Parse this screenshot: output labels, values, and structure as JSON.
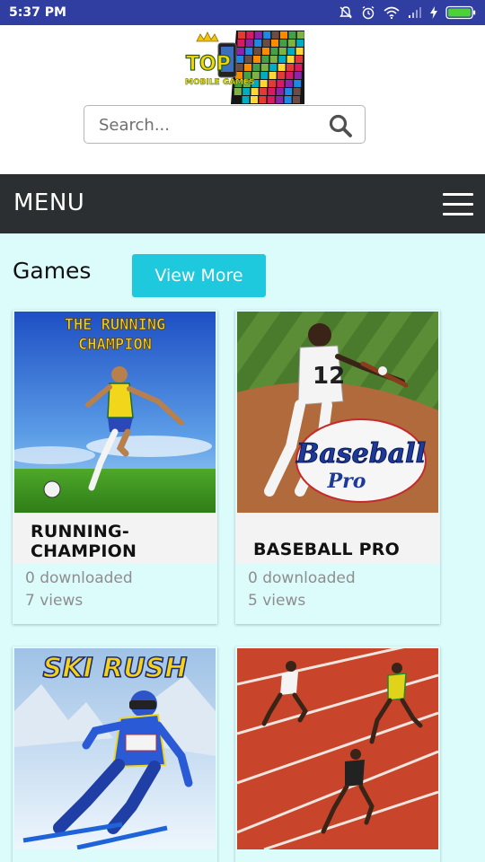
{
  "status_bar": {
    "time": "5:37 PM"
  },
  "header": {
    "logo_text_top": "TOP",
    "logo_text_bottom": "MOBILE GAMES",
    "search_placeholder": "Search..."
  },
  "menu": {
    "label": "MENU"
  },
  "section": {
    "title": "Games",
    "view_more_label": "View More"
  },
  "games": [
    {
      "name": "RUNNING-CHAMPION",
      "name_line1": "RUNNING-",
      "name_line2": "CHAMPION",
      "downloads": "0 downloaded",
      "views": "7 views",
      "image_text": "THE RUNNING CHAMPION",
      "image_line1": "THE RUNNING",
      "image_line2": "CHAMPION"
    },
    {
      "name": "BASEBALL PRO",
      "downloads": "0 downloaded",
      "views": "5 views",
      "image_text": "Baseball Pro",
      "image_line1": "Baseball",
      "image_line2": "Pro",
      "jersey_number": "12"
    },
    {
      "image_text": "SKI RUSH"
    },
    {
      "image_text": ""
    }
  ],
  "colors": {
    "status_bar": "#2f3ea0",
    "menu_bar": "#2b2f32",
    "page_bg": "#dcfbfb",
    "accent": "#1ec8dd"
  }
}
